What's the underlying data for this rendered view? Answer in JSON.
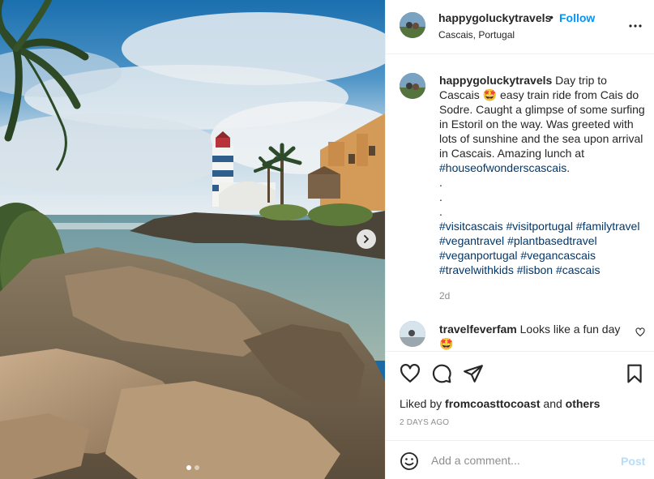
{
  "post": {
    "username": "happygoluckytravels",
    "separator": "•",
    "follow_label": "Follow",
    "location": "Cascais, Portugal",
    "more_icon": "more-horizontal-icon",
    "photo": {
      "description_icon": "coastal-lighthouse-photo",
      "next_icon": "chevron-right-icon",
      "slide_count": 2,
      "active_slide": 1
    }
  },
  "caption": {
    "username": "happygoluckytravels",
    "text_before_emoji": " Day trip to Cascais ",
    "emoji": "🤩",
    "text_after_emoji": " easy train ride from Cais do Sodre. Caught a glimpse of some surfing in Estoril on the way. Was greeted with lots of sunshine and the sea upon arrival in Cascais. Amazing lunch at",
    "first_tag": "#houseofwonderscascais",
    "first_tag_suffix": ".",
    "dots": [
      ".",
      ".",
      "."
    ],
    "hashtags": [
      "#visitcascais",
      "#visitportugal",
      "#familytravel",
      "#vegantravel",
      "#plantbasedtravel",
      "#veganportugal",
      "#vegancascais",
      "#travelwithkids",
      "#lisbon",
      "#cascais"
    ],
    "time": "2d"
  },
  "comment": {
    "username": "travelfeverfam",
    "text": " Looks like a fun day",
    "emoji": "🤩",
    "like_icon": "heart-outline-small-icon"
  },
  "actions": {
    "like_icon": "heart-outline-icon",
    "comment_icon": "comment-bubble-icon",
    "share_icon": "paper-plane-icon",
    "save_icon": "bookmark-icon",
    "liked_by_prefix": "Liked by ",
    "liked_by_user": "fromcoasttocoast",
    "liked_by_middle": " and ",
    "liked_by_others": "others",
    "date": "2 DAYS AGO"
  },
  "add_comment": {
    "emoji_icon": "smiley-icon",
    "placeholder": "Add a comment...",
    "post_label": "Post"
  },
  "colors": {
    "link_blue": "#0095f6",
    "hashtag": "#00376b",
    "muted": "#8e8e8e",
    "post_disabled": "#b2dffc"
  }
}
